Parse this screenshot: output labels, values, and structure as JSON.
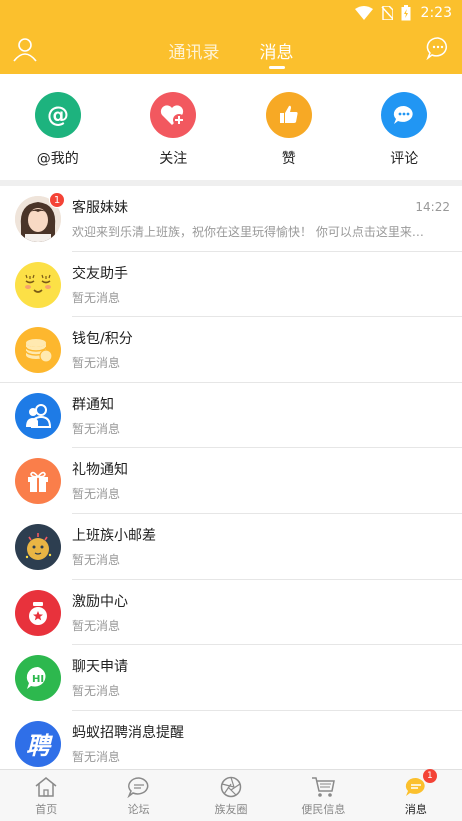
{
  "status": {
    "time": "2:23"
  },
  "header": {
    "tabs": [
      {
        "label": "通讯录",
        "active": false
      },
      {
        "label": "消息",
        "active": true
      }
    ],
    "accent_color": "#FBC02D"
  },
  "quick_actions": [
    {
      "label": "@我的",
      "icon": "at-icon",
      "color": "#1DB37E"
    },
    {
      "label": "关注",
      "icon": "heart-add-icon",
      "color": "#F2585F"
    },
    {
      "label": "赞",
      "icon": "thumbs-up-icon",
      "color": "#F7A925"
    },
    {
      "label": "评论",
      "icon": "comment-icon",
      "color": "#2196F3"
    }
  ],
  "messages": [
    {
      "title": "客服妹妹",
      "subtitle": "欢迎来到乐清上班族，祝你在这里玩得愉快！ 你可以点击这里来…",
      "time": "14:22",
      "badge": "1",
      "icon": "avatar-girl-icon"
    },
    {
      "title": "交友助手",
      "subtitle": "暂无消息",
      "icon": "sleepy-face-icon"
    },
    {
      "title": "钱包/积分",
      "subtitle": "暂无消息",
      "icon": "coins-icon"
    },
    {
      "title": "群通知",
      "subtitle": "暂无消息",
      "icon": "group-icon"
    },
    {
      "title": "礼物通知",
      "subtitle": "暂无消息",
      "icon": "gift-icon"
    },
    {
      "title": "上班族小邮差",
      "subtitle": "暂无消息",
      "icon": "mailman-icon"
    },
    {
      "title": "激励中心",
      "subtitle": "暂无消息",
      "icon": "reward-icon"
    },
    {
      "title": "聊天申请",
      "subtitle": "暂无消息",
      "icon": "hi-chat-icon"
    },
    {
      "title": "蚂蚁招聘消息提醒",
      "subtitle": "暂无消息",
      "icon": "hire-icon",
      "icon_text": "聘"
    }
  ],
  "bottom_nav": [
    {
      "label": "首页",
      "icon": "home-icon",
      "active": false
    },
    {
      "label": "论坛",
      "icon": "forum-icon",
      "active": false
    },
    {
      "label": "族友圈",
      "icon": "aperture-icon",
      "active": false
    },
    {
      "label": "便民信息",
      "icon": "cart-icon",
      "active": false
    },
    {
      "label": "消息",
      "icon": "message-icon",
      "active": true,
      "badge": "1"
    }
  ]
}
